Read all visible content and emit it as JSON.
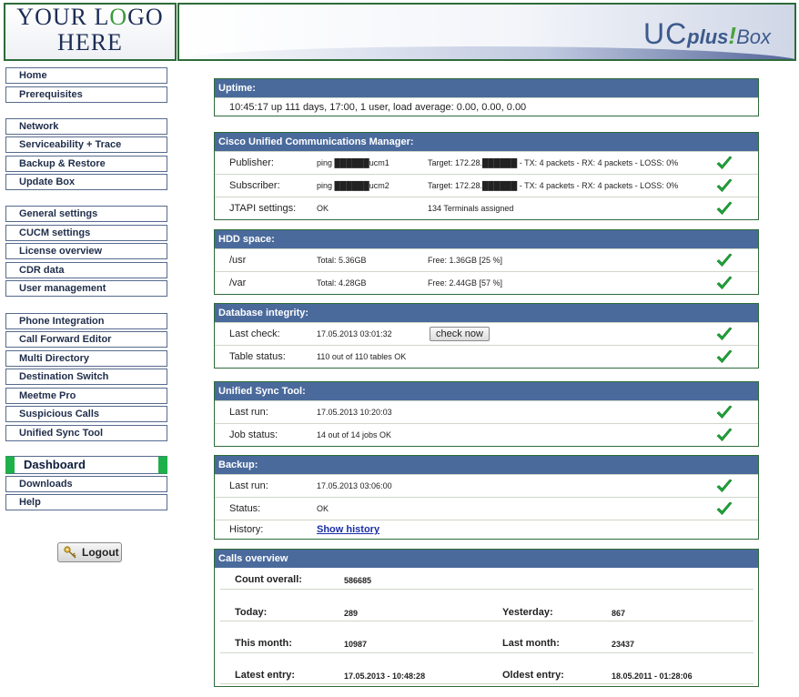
{
  "header": {
    "logo_line1_pre": "YOUR L",
    "logo_line1_o": "O",
    "logo_line1_post": "GO",
    "logo_line2": "HERE",
    "brand_uc": "UC",
    "brand_plus": "plus",
    "brand_excl": "!",
    "brand_box": "Box"
  },
  "sidebar": {
    "groups": [
      [
        "Home",
        "Prerequisites"
      ],
      [
        "Network",
        "Serviceability + Trace",
        "Backup & Restore",
        "Update Box"
      ],
      [
        "General settings",
        "CUCM settings",
        "License overview",
        "CDR data",
        "User management"
      ],
      [
        "Phone Integration",
        "Call Forward Editor",
        "Multi Directory",
        "Destination Switch",
        "Meetme Pro",
        "Suspicious Calls",
        "Unified Sync Tool"
      ],
      [
        "Dashboard",
        "Downloads",
        "Help"
      ]
    ],
    "active": "Dashboard",
    "logout_label": "Logout"
  },
  "uptime": {
    "title": "Uptime:",
    "value": "10:45:17 up 111 days, 17:00, 1 user, load average: 0.00, 0.00, 0.00"
  },
  "cucm": {
    "title": "Cisco Unified Communications Manager:",
    "rows": [
      {
        "label": "Publisher:",
        "v1": "ping ██████ucm1",
        "v2": "Target: 172.28.██████ - TX: 4 packets - RX: 4 packets - LOSS: 0%"
      },
      {
        "label": "Subscriber:",
        "v1": "ping ██████ucm2",
        "v2": "Target: 172.28.██████ - TX: 4 packets - RX: 4 packets - LOSS: 0%"
      },
      {
        "label": "JTAPI settings:",
        "v1": "OK",
        "v2": "134 Terminals assigned"
      }
    ]
  },
  "hdd": {
    "title": "HDD space:",
    "rows": [
      {
        "label": "/usr",
        "v1": "Total: 5.36GB",
        "v2": "Free: 1.36GB [25 %]"
      },
      {
        "label": "/var",
        "v1": "Total: 4.28GB",
        "v2": "Free: 2.44GB [57 %]"
      }
    ]
  },
  "database": {
    "title": "Database integrity:",
    "rows": [
      {
        "label": "Last check:",
        "v1": "17.05.2013 03:01:32"
      },
      {
        "label": "Table status:",
        "v1": "110 out of 110 tables OK"
      }
    ],
    "check_now_label": "check now"
  },
  "sync": {
    "title": "Unified Sync Tool:",
    "rows": [
      {
        "label": "Last run:",
        "v1": "17.05.2013 10:20:03"
      },
      {
        "label": "Job status:",
        "v1": "14 out of 14 jobs OK"
      }
    ]
  },
  "backup": {
    "title": "Backup:",
    "rows": [
      {
        "label": "Last run:",
        "v1": "17.05.2013 03:06:00"
      },
      {
        "label": "Status:",
        "v1": "OK"
      },
      {
        "label": "History:"
      }
    ],
    "history_link": "Show history"
  },
  "calls": {
    "title": "Calls overview",
    "count_overall_label": "Count overall:",
    "count_overall": "586685",
    "today_label": "Today:",
    "today": "289",
    "yesterday_label": "Yesterday:",
    "yesterday": "867",
    "this_month_label": "This month:",
    "this_month": "10987",
    "last_month_label": "Last month:",
    "last_month": "23437",
    "latest_entry_label": "Latest entry:",
    "latest_entry": "17.05.2013 - 10:48:28",
    "oldest_entry_label": "Oldest entry:",
    "oldest_entry": "18.05.2011 - 01:28:06"
  },
  "colors": {
    "panel_header": "#4a6a9c",
    "panel_border": "#2e6b3a",
    "active_marker": "#1eb04a",
    "check_green": "#1ea83a"
  }
}
